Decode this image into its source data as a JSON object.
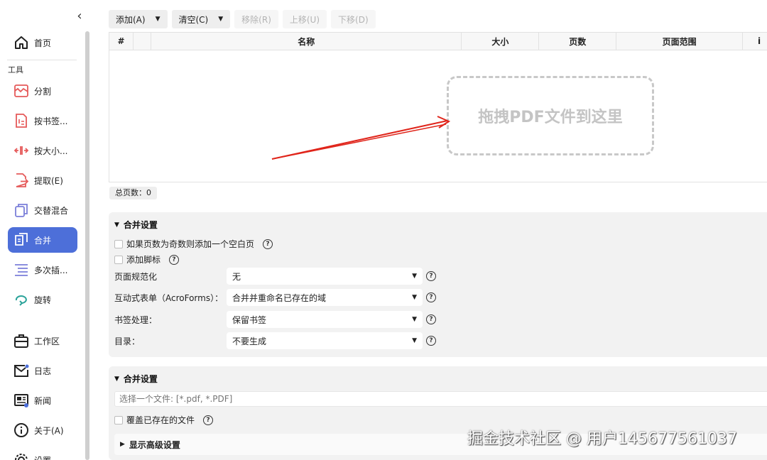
{
  "sidebar": {
    "collapse_icon": "chevron-left-icon",
    "home": {
      "label": "首页",
      "icon": "home-icon"
    },
    "section_tools": "工具",
    "tools": [
      {
        "label": "分割",
        "icon": "split-icon"
      },
      {
        "label": "按书签...",
        "icon": "bookmark-split-icon"
      },
      {
        "label": "按大小...",
        "icon": "size-split-icon"
      },
      {
        "label": "提取(E)",
        "icon": "extract-icon"
      },
      {
        "label": "交替混合",
        "icon": "alternate-mix-icon"
      },
      {
        "label": "合并",
        "icon": "merge-icon",
        "active": true
      },
      {
        "label": "多次插...",
        "icon": "multi-insert-icon"
      },
      {
        "label": "旋转",
        "icon": "rotate-icon"
      }
    ],
    "bottom": [
      {
        "label": "工作区",
        "icon": "briefcase-icon"
      },
      {
        "label": "日志",
        "icon": "mail-icon"
      },
      {
        "label": "新闻",
        "icon": "news-icon"
      },
      {
        "label": "关于(A)",
        "icon": "info-icon"
      },
      {
        "label": "设置",
        "icon": "gear-icon"
      }
    ]
  },
  "toolbar": {
    "add": "添加(A)",
    "clear": "清空(C)",
    "remove": "移除(R)",
    "move_up": "上移(U)",
    "move_down": "下移(D)"
  },
  "table": {
    "columns": [
      "#",
      "",
      "名称",
      "大小",
      "页数",
      "页面范围",
      "i"
    ],
    "rows": []
  },
  "drop_zone_text": "拖拽PDF文件到这里",
  "total_pages": "总页数：0",
  "merge_settings": {
    "title": "合并设置",
    "blank_page_label": "如果页数为奇数则添加一个空白页",
    "footer_label": "添加脚标",
    "page_norm_label": "页面规范化",
    "page_norm_value": "无",
    "acroforms_label": "互动式表单（AcroForms）：",
    "acroforms_value": "合并并重命名已存在的域",
    "bookmark_label": "书签处理：",
    "bookmark_value": "保留书签",
    "toc_label": "目录：",
    "toc_value": "不要生成"
  },
  "output_settings": {
    "title": "合并设置",
    "file_placeholder": "选择一个文件: [*.pdf, *.PDF]",
    "overwrite_label": "覆盖已存在的文件",
    "advanced_label": "显示高级设置"
  },
  "watermark": "掘金技术社区 @ 用户145677561037",
  "colors": {
    "accent": "#4d6fd9",
    "arrow": "#e0251b"
  }
}
